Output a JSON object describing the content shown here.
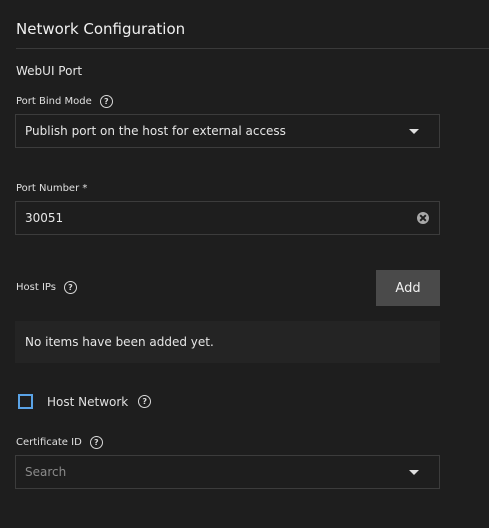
{
  "section": {
    "title": "Network Configuration",
    "subsection_title": "WebUI Port"
  },
  "port_bind_mode": {
    "label": "Port Bind Mode",
    "value": "Publish port on the host for external access"
  },
  "port_number": {
    "label": "Port Number *",
    "value": "30051"
  },
  "host_ips": {
    "label": "Host IPs",
    "add_label": "Add",
    "empty_text": "No items have been added yet."
  },
  "host_network": {
    "label": "Host Network",
    "checked": false
  },
  "certificate": {
    "label": "Certificate ID",
    "placeholder": "Search"
  },
  "icons": {
    "help": "?"
  },
  "colors": {
    "background": "#1e1e1e",
    "checkbox_accent": "#5aa3e6",
    "button": "#4a4a4a"
  }
}
